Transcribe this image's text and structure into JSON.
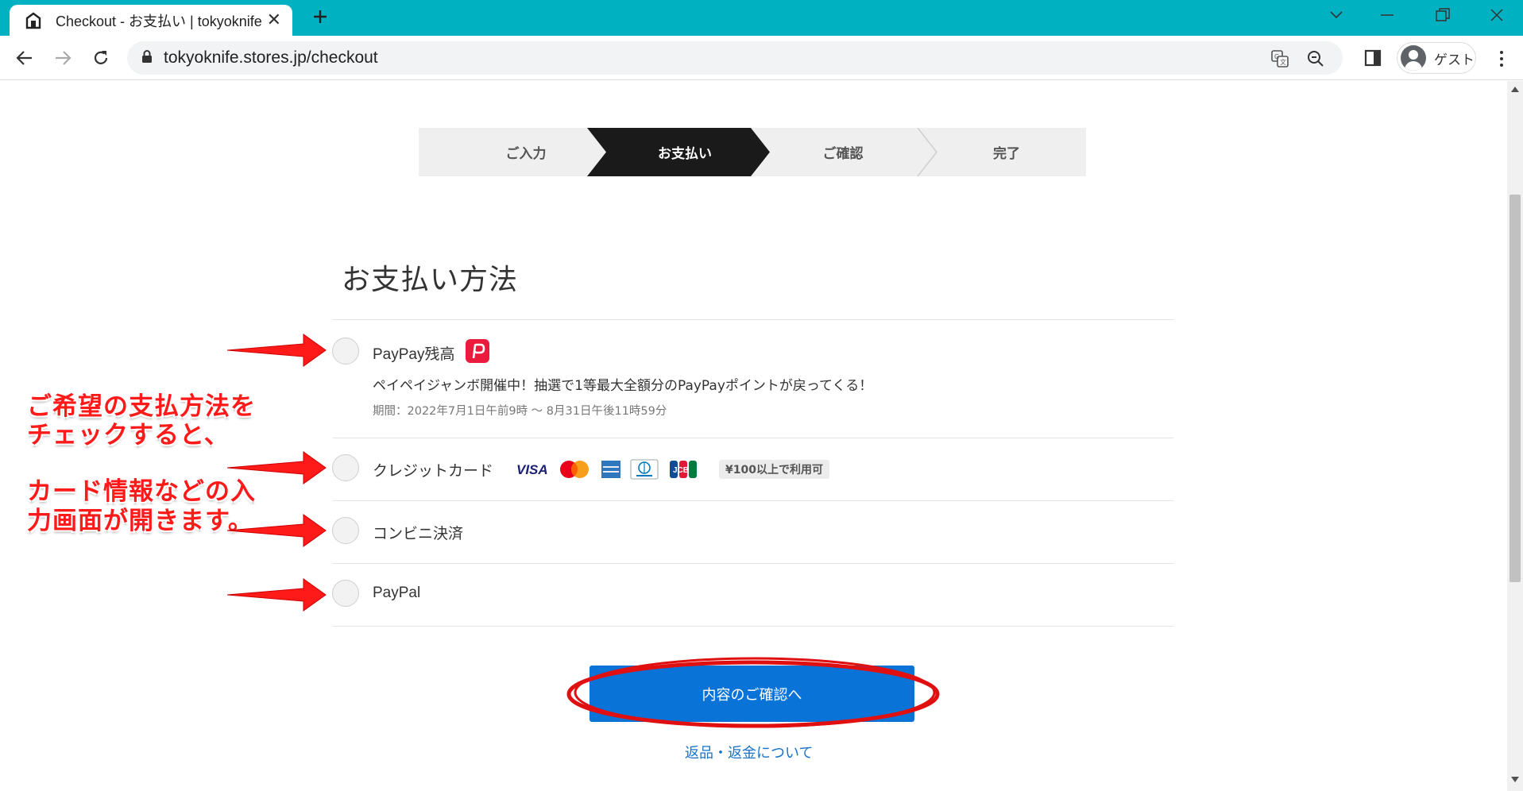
{
  "browser": {
    "tab_title": "Checkout - お支払い | tokyoknife",
    "url": "tokyoknife.stores.jp/checkout",
    "profile_name": "ゲスト",
    "accent_color": "#00b1c1"
  },
  "steps": [
    {
      "label": "ご入力",
      "active": false
    },
    {
      "label": "お支払い",
      "active": true
    },
    {
      "label": "ご確認",
      "active": false
    },
    {
      "label": "完了",
      "active": false
    }
  ],
  "payment": {
    "title": "お支払い方法",
    "options": [
      {
        "label": "PayPay残高",
        "icon": "paypay-icon",
        "selected": false
      },
      {
        "label": "クレジットカード",
        "selected": false
      },
      {
        "label": "コンビニ決済",
        "selected": false
      },
      {
        "label": "PayPal",
        "selected": false
      }
    ],
    "paypay_promo": "ペイペイジャンボ開催中！抽選で1等最大全額分のPayPayポイントが戻ってくる！",
    "paypay_period": "期間：2022年7月1日午前9時 〜 8月31日午後11時59分",
    "card_brands": [
      "VISA",
      "Mastercard",
      "American Express",
      "Diners Club",
      "JCB"
    ],
    "visa_text": "VISA",
    "jcb_text": "JCB",
    "credit_badge": "¥100以上で利用可"
  },
  "confirm_button": "内容のご確認へ",
  "returns_link": "返品・返金について",
  "annotation": {
    "line1": "ご希望の支払方法を",
    "line2": "チェックすると、",
    "line3": "カード情報などの入",
    "line4": "力画面が開きます。",
    "color": "#ff1a1a"
  }
}
